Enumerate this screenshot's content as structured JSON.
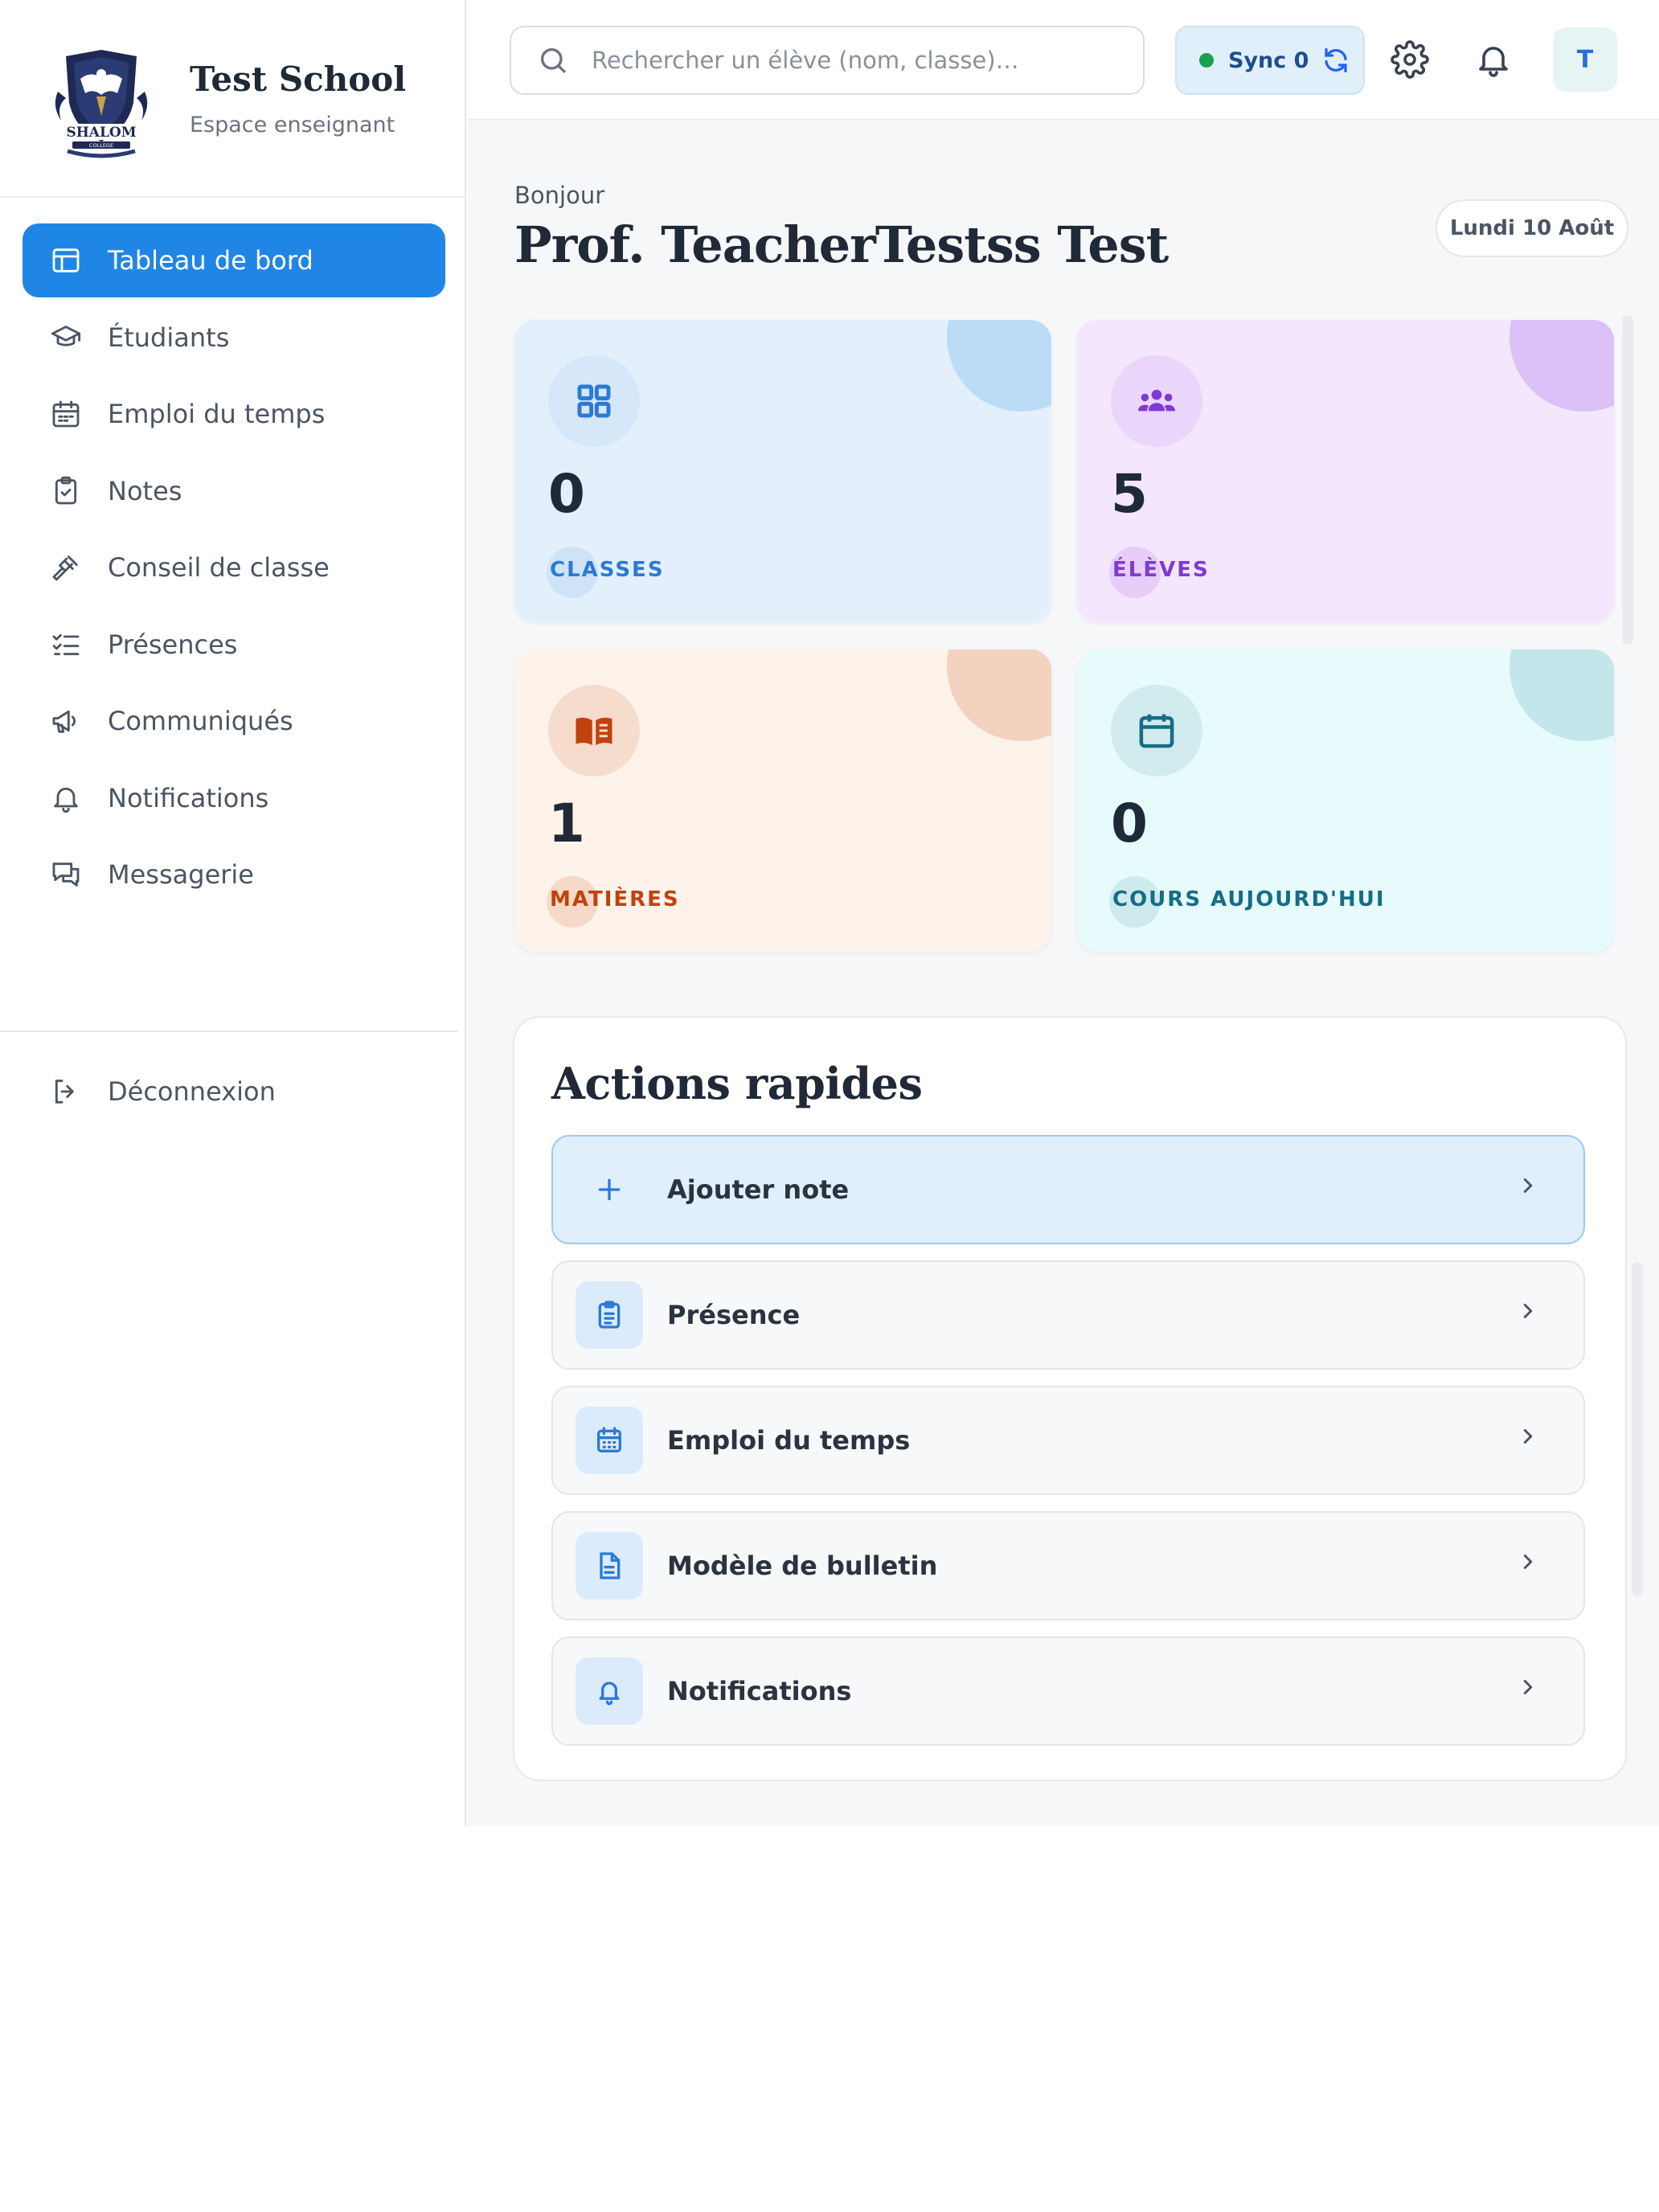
{
  "brand": {
    "school_name": "Test School",
    "subtitle": "Espace enseignant",
    "logo_text": "SHALOM",
    "logo_subtext": "COLLEGE"
  },
  "nav": {
    "items": [
      {
        "label": "Tableau de bord",
        "icon": "layout-dashboard-icon",
        "active": true
      },
      {
        "label": "Étudiants",
        "icon": "graduation-cap-icon"
      },
      {
        "label": "Emploi du temps",
        "icon": "calendar-icon"
      },
      {
        "label": "Notes",
        "icon": "clipboard-check-icon"
      },
      {
        "label": "Conseil de classe",
        "icon": "gavel-icon"
      },
      {
        "label": "Présences",
        "icon": "list-checks-icon"
      },
      {
        "label": "Communiqués",
        "icon": "megaphone-icon"
      },
      {
        "label": "Notifications",
        "icon": "bell-icon"
      },
      {
        "label": "Messagerie",
        "icon": "messages-icon"
      }
    ],
    "logout": "Déconnexion"
  },
  "topbar": {
    "search_placeholder": "Rechercher un élève (nom, classe)…",
    "sync_label": "Sync 0",
    "avatar_initial": "T"
  },
  "greeting": {
    "hello": "Bonjour",
    "name": "Prof. TeacherTestss Test",
    "date": "Lundi 10 Août"
  },
  "stats": [
    {
      "value": "0",
      "label": "CLASSES",
      "color": "#2b7ad6",
      "bg": "#e3f0fc",
      "blob": "#bcdcf6",
      "icon_bg": "#d5e7f9"
    },
    {
      "value": "5",
      "label": "ÉLÈVES",
      "color": "#7e3ad6",
      "bg": "#f3e6fd",
      "blob": "#dcc0f8",
      "icon_bg": "#ead6fb"
    },
    {
      "value": "1",
      "label": "MATIÈRES",
      "color": "#c2410c",
      "bg": "#fdf3ea",
      "blob": "#f3d2bf",
      "icon_bg": "#f6dccd"
    },
    {
      "value": "0",
      "label": "COURS AUJOURD'HUI",
      "color": "#166d86",
      "bg": "#e7fbfd",
      "blob": "#c2e6ea",
      "icon_bg": "#d2ebee"
    }
  ],
  "quick_actions": {
    "title": "Actions rapides",
    "items": [
      {
        "label": "Ajouter note",
        "icon": "plus-icon"
      },
      {
        "label": "Présence",
        "icon": "clipboard-list-icon"
      },
      {
        "label": "Emploi du temps",
        "icon": "calendar-days-icon"
      },
      {
        "label": "Modèle de bulletin",
        "icon": "file-text-icon"
      },
      {
        "label": "Notifications",
        "icon": "bell-icon"
      }
    ]
  }
}
